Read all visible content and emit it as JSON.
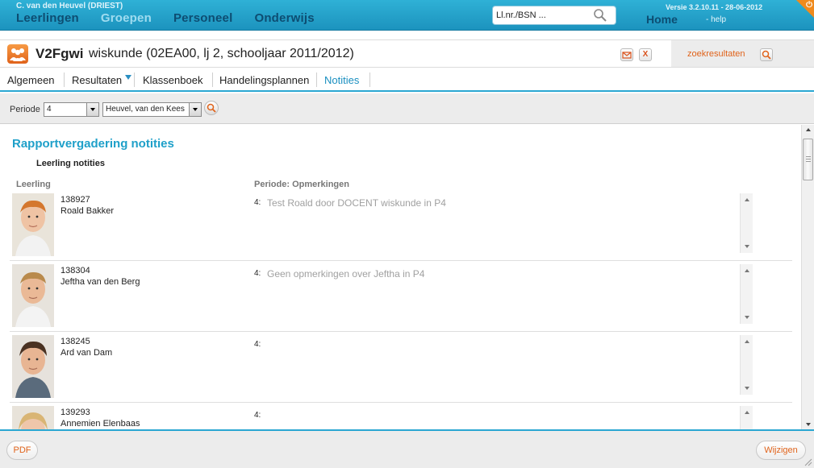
{
  "user": {
    "name": "C. van den Heuvel (DRIEST)"
  },
  "nav": {
    "items": [
      {
        "label": "Leerlingen",
        "active": false
      },
      {
        "label": "Groepen",
        "active": true
      },
      {
        "label": "Personeel",
        "active": false
      },
      {
        "label": "Onderwijs",
        "active": false
      }
    ],
    "home": "Home",
    "help": "- help"
  },
  "search": {
    "value": "Ll.nr./BSN ..."
  },
  "version": "Versie 3.2.10.11 - 28-06-2012",
  "header": {
    "code": "V2Fgwi",
    "description": "wiskunde (02EA00, lj 2, schooljaar 2011/2012)",
    "close_label": "X",
    "zoekresultaten": "zoekresultaten"
  },
  "tabs": [
    {
      "label": "Algemeen"
    },
    {
      "label": "Resultaten"
    },
    {
      "label": "Klassenboek"
    },
    {
      "label": "Handelingsplannen"
    },
    {
      "label": "Notities"
    }
  ],
  "filter": {
    "periode_label": "Periode",
    "periode_value": "4",
    "teacher_value": "Heuvel, van den Kees"
  },
  "content": {
    "section_title": "Rapportvergadering notities",
    "subtitle": "Leerling notities",
    "col_leerling": "Leerling",
    "col_periode": "Periode: Opmerkingen",
    "students": [
      {
        "nr": "138927",
        "name": "Roald Bakker",
        "periode": "4:",
        "note": "Test Roald door DOCENT wiskunde in P4"
      },
      {
        "nr": "138304",
        "name": "Jeftha van den Berg",
        "periode": "4:",
        "note": "Geen opmerkingen over Jeftha in P4"
      },
      {
        "nr": "138245",
        "name": "Ard van Dam",
        "periode": "4:",
        "note": ""
      },
      {
        "nr": "139293",
        "name": "Annemien Elenbaas",
        "periode": "4:",
        "note": ""
      }
    ]
  },
  "footer": {
    "pdf": "PDF",
    "wijzigen": "Wijzigen"
  },
  "colors": {
    "accent": "#1fa0c9",
    "orange": "#e0631b",
    "topbar": "#2fb1d6"
  }
}
